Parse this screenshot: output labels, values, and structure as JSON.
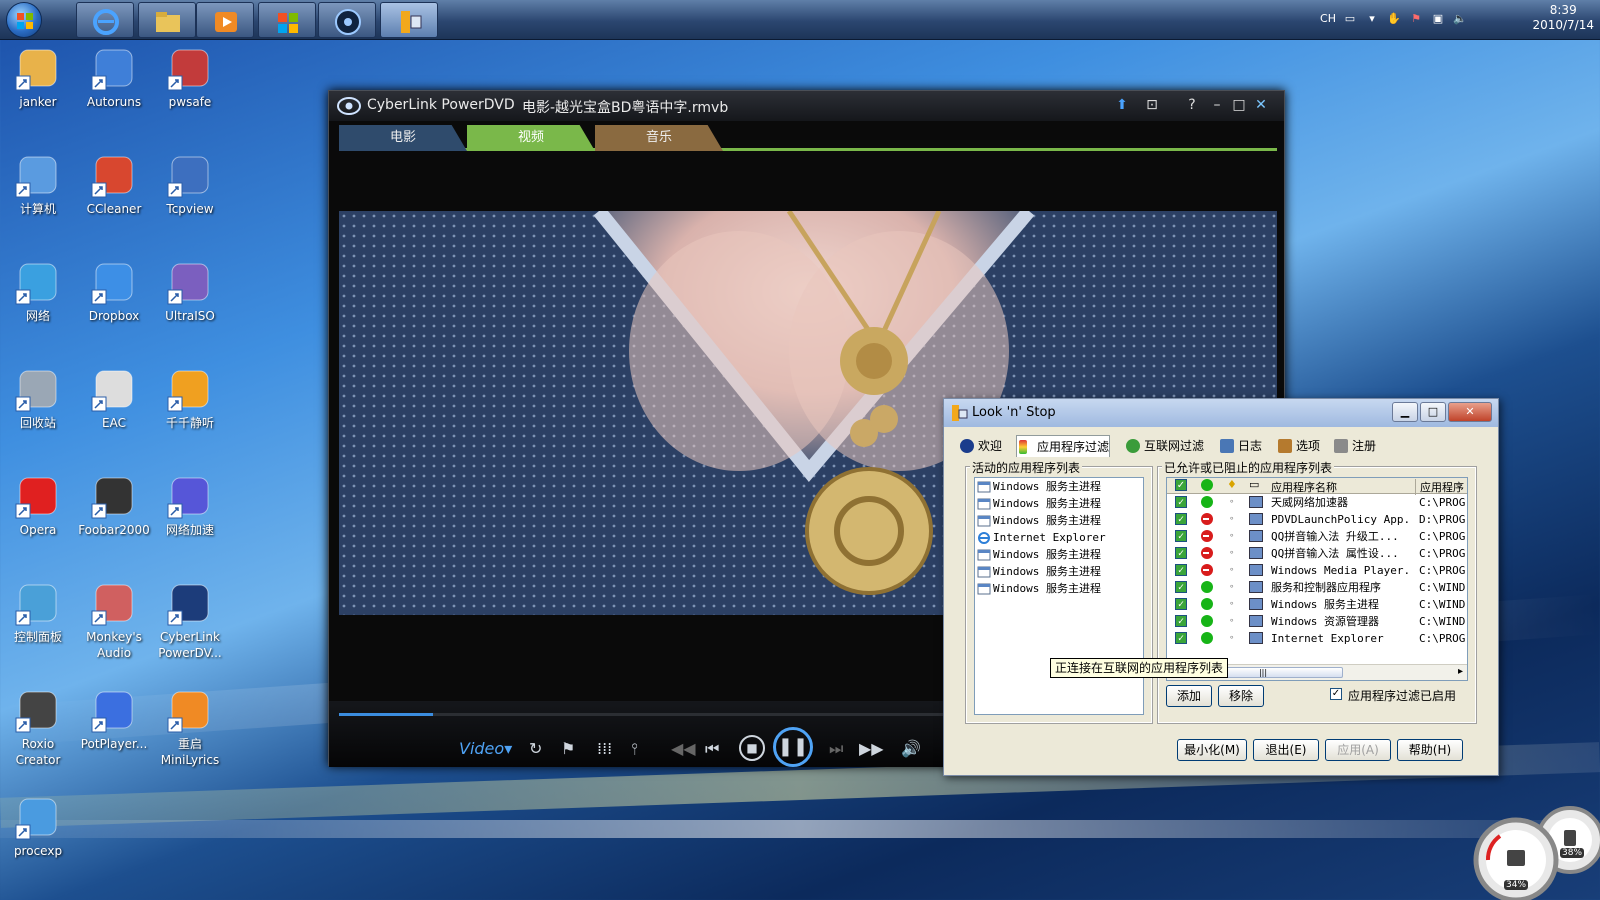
{
  "taskbar": {
    "clock_time": "8:39",
    "clock_date": "2010/7/14",
    "tray_lang": "CH"
  },
  "desktop_icons": [
    {
      "label": "janker",
      "icon": "user-folder-icon"
    },
    {
      "label": "Autoruns",
      "icon": "autoruns-icon"
    },
    {
      "label": "pwsafe",
      "icon": "pwsafe-icon"
    },
    {
      "label": "计算机",
      "icon": "computer-icon"
    },
    {
      "label": "CCleaner",
      "icon": "ccleaner-icon"
    },
    {
      "label": "Tcpview",
      "icon": "tcpview-icon"
    },
    {
      "label": "网络",
      "icon": "network-icon"
    },
    {
      "label": "Dropbox",
      "icon": "dropbox-icon"
    },
    {
      "label": "UltraISO",
      "icon": "ultraiso-icon"
    },
    {
      "label": "回收站",
      "icon": "recycle-bin-icon"
    },
    {
      "label": "EAC",
      "icon": "eac-icon"
    },
    {
      "label": "千千静听",
      "icon": "ttplayer-icon"
    },
    {
      "label": "Opera",
      "icon": "opera-icon"
    },
    {
      "label": "Foobar2000",
      "icon": "foobar-icon"
    },
    {
      "label": "网络加速",
      "icon": "net-accel-icon"
    },
    {
      "label": "控制面板",
      "icon": "control-panel-icon"
    },
    {
      "label": "Monkey's Audio",
      "icon": "monkeys-audio-icon"
    },
    {
      "label": "CyberLink PowerDV...",
      "icon": "powerdvd-icon"
    },
    {
      "label": "Roxio Creator",
      "icon": "roxio-icon"
    },
    {
      "label": "PotPlayer...",
      "icon": "potplayer-icon"
    },
    {
      "label": "重启 MiniLyrics",
      "icon": "minilyrics-icon"
    },
    {
      "label": "procexp",
      "icon": "procexp-icon"
    }
  ],
  "powerdvd": {
    "app_title": "CyberLink PowerDVD",
    "file_title": "电影-越光宝盒BD粤语中字.rmvb",
    "tabs": [
      "电影",
      "视频",
      "音乐"
    ],
    "active_tab": "视频",
    "mode_label": "Video",
    "progress": 0.1
  },
  "lns": {
    "title": "Look 'n' Stop",
    "tabs": [
      "欢迎",
      "应用程序过滤",
      "互联网过滤",
      "日志",
      "选项",
      "注册"
    ],
    "left_group": "活动的应用程序列表",
    "right_group": "已允许或已阻止的应用程序列表",
    "active_apps": [
      {
        "name": "Windows 服务主进程",
        "icon": "window-icon"
      },
      {
        "name": "Windows 服务主进程",
        "icon": "window-icon"
      },
      {
        "name": "Windows 服务主进程",
        "icon": "window-icon"
      },
      {
        "name": "Internet Explorer",
        "icon": "ie-icon"
      },
      {
        "name": "Windows 服务主进程",
        "icon": "window-icon"
      },
      {
        "name": "Windows 服务主进程",
        "icon": "window-icon"
      },
      {
        "name": "Windows 服务主进程",
        "icon": "window-icon"
      }
    ],
    "col_name": "应用程序名称",
    "col_path": "应用程序",
    "apps": [
      {
        "name": "天威网络加速器",
        "path": "C:\\PROG",
        "status": "allow"
      },
      {
        "name": "PDVDLaunchPolicy App...",
        "path": "D:\\PROG",
        "status": "block"
      },
      {
        "name": "QQ拼音输入法 升级工...",
        "path": "C:\\PROG",
        "status": "block"
      },
      {
        "name": "QQ拼音输入法 属性设...",
        "path": "C:\\PROG",
        "status": "block"
      },
      {
        "name": "Windows Media Player...",
        "path": "C:\\PROG",
        "status": "block"
      },
      {
        "name": "服务和控制器应用程序",
        "path": "C:\\WIND",
        "status": "allow"
      },
      {
        "name": "Windows 服务主进程",
        "path": "C:\\WIND",
        "status": "allow"
      },
      {
        "name": "Windows 资源管理器",
        "path": "C:\\WIND",
        "status": "allow"
      },
      {
        "name": "Internet Explorer",
        "path": "C:\\PROG",
        "status": "allow"
      }
    ],
    "tooltip": "正连接在互联网的应用程序列表",
    "add_button": "添加",
    "remove_button": "移除",
    "filter_enabled_label": "应用程序过滤已启用",
    "filter_enabled": true,
    "bottom_buttons": [
      "最小化(M)",
      "退出(E)",
      "应用(A)",
      "帮助(H)"
    ],
    "colors": {
      "allow": "#17b417",
      "block": "#d81c1c"
    }
  },
  "gadget": {
    "cpu": "34%",
    "mem": "38%"
  }
}
